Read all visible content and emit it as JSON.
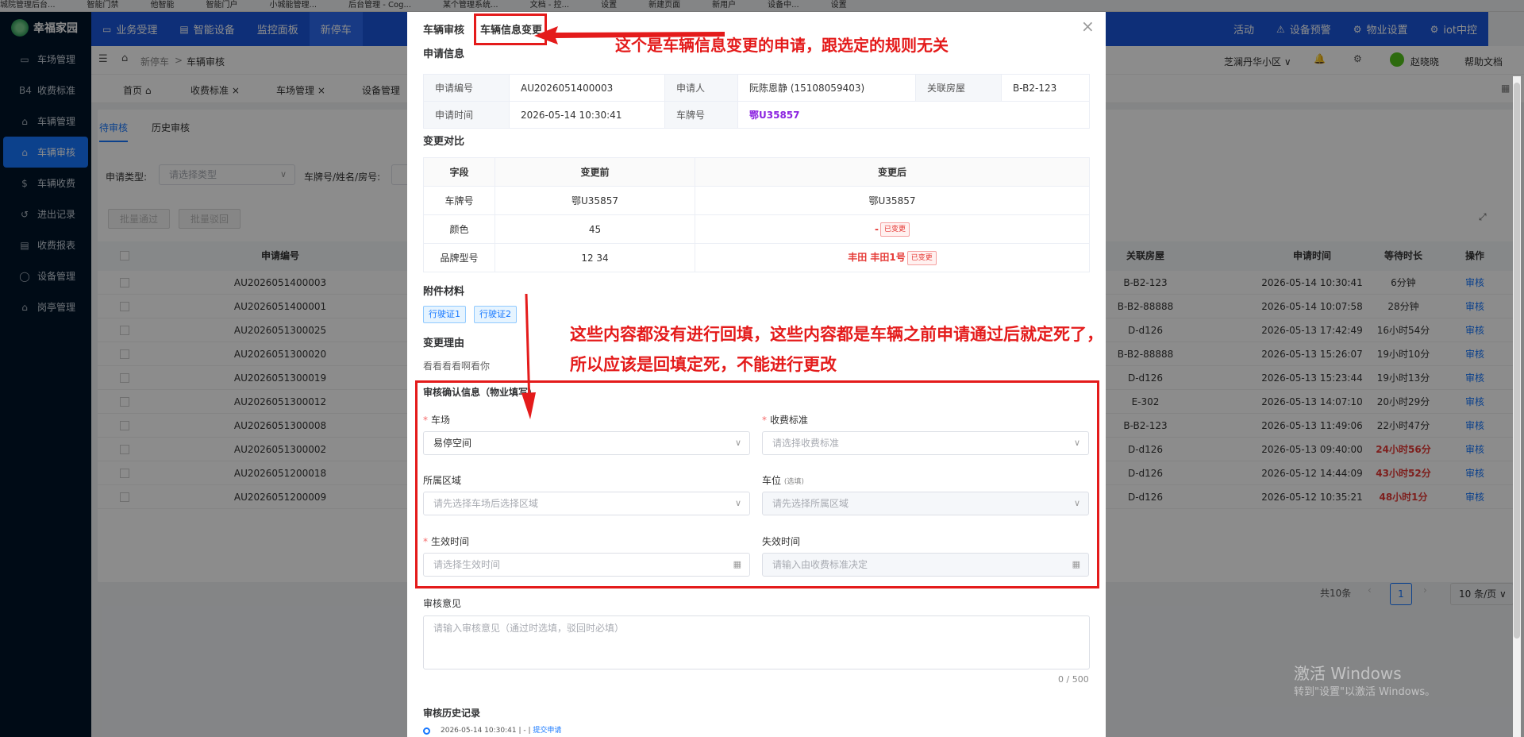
{
  "bookmarks": [
    "城院管理后台...",
    "智能门禁",
    "他智能",
    "智能门户",
    "小城能管理...",
    "后台管理 - Cog...",
    "某个管理系统...",
    "文档 - 控...",
    "设置",
    "新建页面",
    "新用户",
    "设备中...",
    "设置"
  ],
  "sidebar": {
    "logo": "幸福家园",
    "items": [
      {
        "icon": "▭",
        "label": "车场管理"
      },
      {
        "icon": "B4",
        "label": "收费标准"
      },
      {
        "icon": "⌂",
        "label": "车辆管理"
      },
      {
        "icon": "⌂",
        "label": "车辆审核"
      },
      {
        "icon": "$",
        "label": "车辆收费"
      },
      {
        "icon": "↺",
        "label": "进出记录"
      },
      {
        "icon": "▤",
        "label": "收费报表"
      },
      {
        "icon": "◯",
        "label": "设备管理"
      },
      {
        "icon": "⌂",
        "label": "岗亭管理"
      }
    ]
  },
  "topnav": {
    "items": [
      "业务受理",
      "智能设备",
      "监控面板",
      "新停车"
    ],
    "right_items": [
      "活动",
      "设备预警",
      "物业设置",
      "iot中控"
    ]
  },
  "header": {
    "breadcrumb": [
      "新停车",
      "车辆审核"
    ],
    "community": "芝澜丹华小区",
    "user": "赵晓晓",
    "help": "帮助文档"
  },
  "tags": [
    "首页",
    "收费标准",
    "车场管理",
    "设备管理"
  ],
  "page": {
    "tabs": [
      "待审核",
      "历史审核"
    ],
    "filter_type_label": "申请类型:",
    "filter_type_placeholder": "请选择类型",
    "filter_plate_label": "车牌号/姓名/房号:",
    "batch_pass": "批量通过",
    "batch_reject": "批量驳回",
    "columns": [
      "申请编号",
      "关联房屋",
      "申请时间",
      "等待时长",
      "操作"
    ],
    "rows": [
      {
        "id": "AU2026051400003",
        "house": "B-B2-123",
        "time": "2026-05-14 10:30:41",
        "wait": "6分钟",
        "red": false
      },
      {
        "id": "AU2026051400001",
        "house": "B-B2-88888",
        "time": "2026-05-14 10:07:58",
        "wait": "28分钟",
        "red": false
      },
      {
        "id": "AU2026051300025",
        "house": "D-d126",
        "time": "2026-05-13 17:42:49",
        "wait": "16小时54分",
        "red": false
      },
      {
        "id": "AU2026051300020",
        "house": "B-B2-88888",
        "time": "2026-05-13 15:26:07",
        "wait": "19小时10分",
        "red": false
      },
      {
        "id": "AU2026051300019",
        "house": "D-d126",
        "time": "2026-05-13 15:23:44",
        "wait": "19小时13分",
        "red": false
      },
      {
        "id": "AU2026051300012",
        "house": "E-302",
        "time": "2026-05-13 14:07:10",
        "wait": "20小时29分",
        "red": false
      },
      {
        "id": "AU2026051300008",
        "house": "B-B2-123",
        "time": "2026-05-13 11:49:06",
        "wait": "22小时47分",
        "red": false
      },
      {
        "id": "AU2026051300002",
        "house": "D-d126",
        "time": "2026-05-13 09:40:00",
        "wait": "24小时56分",
        "red": true
      },
      {
        "id": "AU2026051200018",
        "house": "D-d126",
        "time": "2026-05-12 14:44:09",
        "wait": "43小时52分",
        "red": true
      },
      {
        "id": "AU2026051200009",
        "house": "D-d126",
        "time": "2026-05-12 10:35:21",
        "wait": "48小时1分",
        "red": true
      }
    ],
    "action": "审核",
    "total": "共10条",
    "page": "1",
    "page_size": "10 条/页"
  },
  "modal": {
    "title_a": "车辆审核",
    "title_b": "车辆信息变更",
    "apply_info_title": "申请信息",
    "apply_no_label": "申请编号",
    "apply_no": "AU2026051400003",
    "applicant_label": "申请人",
    "applicant": "阮陈恩静 (15108059403)",
    "house_label": "关联房屋",
    "house": "B-B2-123",
    "apply_time_label": "申请时间",
    "apply_time": "2026-05-14 10:30:41",
    "plate_label": "车牌号",
    "plate": "鄂U35857",
    "compare_title": "变更对比",
    "compare_cols": [
      "字段",
      "变更前",
      "变更后"
    ],
    "compare_rows": [
      {
        "field": "车牌号",
        "before": "鄂U35857",
        "after": "鄂U35857",
        "changed": false
      },
      {
        "field": "颜色",
        "before": "45",
        "after": "-",
        "changed": true
      },
      {
        "field": "品牌型号",
        "before": "12 34",
        "after": "丰田 丰田1号",
        "changed": true
      }
    ],
    "changed_tag": "已变更",
    "attach_title": "附件材料",
    "attachments": [
      "行驶证1",
      "行驶证2"
    ],
    "reason_title": "变更理由",
    "reason": "看看看看啊看你",
    "confirm_title": "审核确认信息（物业填写）",
    "lot_label": "车场",
    "lot_value": "易停空间",
    "fee_label": "收费标准",
    "fee_placeholder": "请选择收费标准",
    "area_label": "所属区域",
    "area_placeholder": "请先选择车场后选择区域",
    "spot_label": "车位",
    "spot_optional": "(选填)",
    "spot_placeholder": "请先选择所属区域",
    "eff_label": "生效时间",
    "eff_placeholder": "请选择生效时间",
    "exp_label": "失效时间",
    "exp_placeholder": "请输入由收费标准决定",
    "opinion_title": "审核意见",
    "opinion_placeholder": "请输入审核意见（通过时选填，驳回时必填）",
    "opinion_count": "0 / 500",
    "history_title": "审核历史记录",
    "history_item_time": "2026-05-14 10:30:41 | - |",
    "history_item_action": "提交申请"
  },
  "annotations": {
    "top": "这个是车辆信息变更的申请，跟选定的规则无关",
    "middle_1": "这些内容都没有进行回填，这些内容都是车辆之前申请通过后就定死了，",
    "middle_2": "所以应该是回填定死，不能进行更改"
  },
  "watermark": {
    "line1": "激活 Windows",
    "line2": "转到\"设置\"以激活 Windows。"
  },
  "colors": {
    "accent": "#1677ff",
    "nav": "#1a56db",
    "annotation": "#e41b1b",
    "plate": "#8b22e0"
  }
}
